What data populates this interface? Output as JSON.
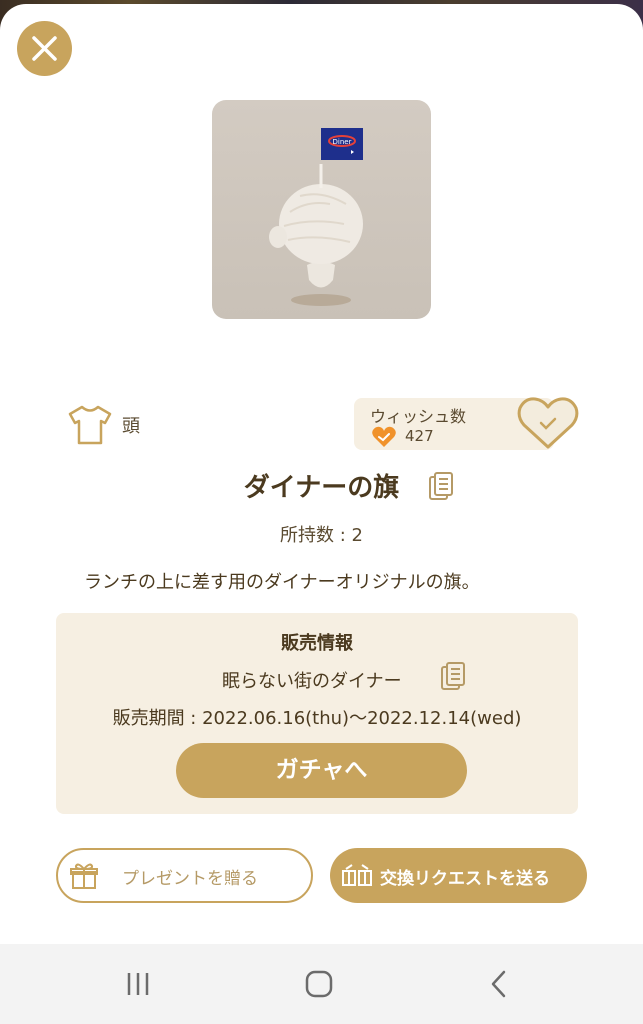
{
  "item": {
    "category": "頭",
    "title": "ダイナーの旗",
    "owned": "所持数 : 2",
    "description": "ランチの上に差す用のダイナーオリジナルの旗。"
  },
  "wish": {
    "label": "ウィッシュ数",
    "count": "427"
  },
  "sales": {
    "heading": "販売情報",
    "event_name": "眠らない街のダイナー",
    "period": "販売期間 : 2022.06.16(thu)〜2022.12.14(wed)",
    "gacha_button": "ガチャへ"
  },
  "actions": {
    "present": "プレゼントを贈る",
    "trade": "交換リクエストを送る"
  },
  "icons": {
    "close": "close-icon",
    "category": "shirt-icon",
    "wish_small": "heart-check-icon",
    "wish_toggle": "heart-outline-icon",
    "copy": "copy-icon",
    "gift": "gift-icon",
    "trade": "exchange-icon",
    "nav_recent": "recent-apps-icon",
    "nav_home": "home-icon",
    "nav_back": "back-icon"
  },
  "colors": {
    "accent": "#c8a45d",
    "panel": "#f6efe2",
    "text": "#4b3a1f",
    "wish_heart": "#f0922b"
  }
}
